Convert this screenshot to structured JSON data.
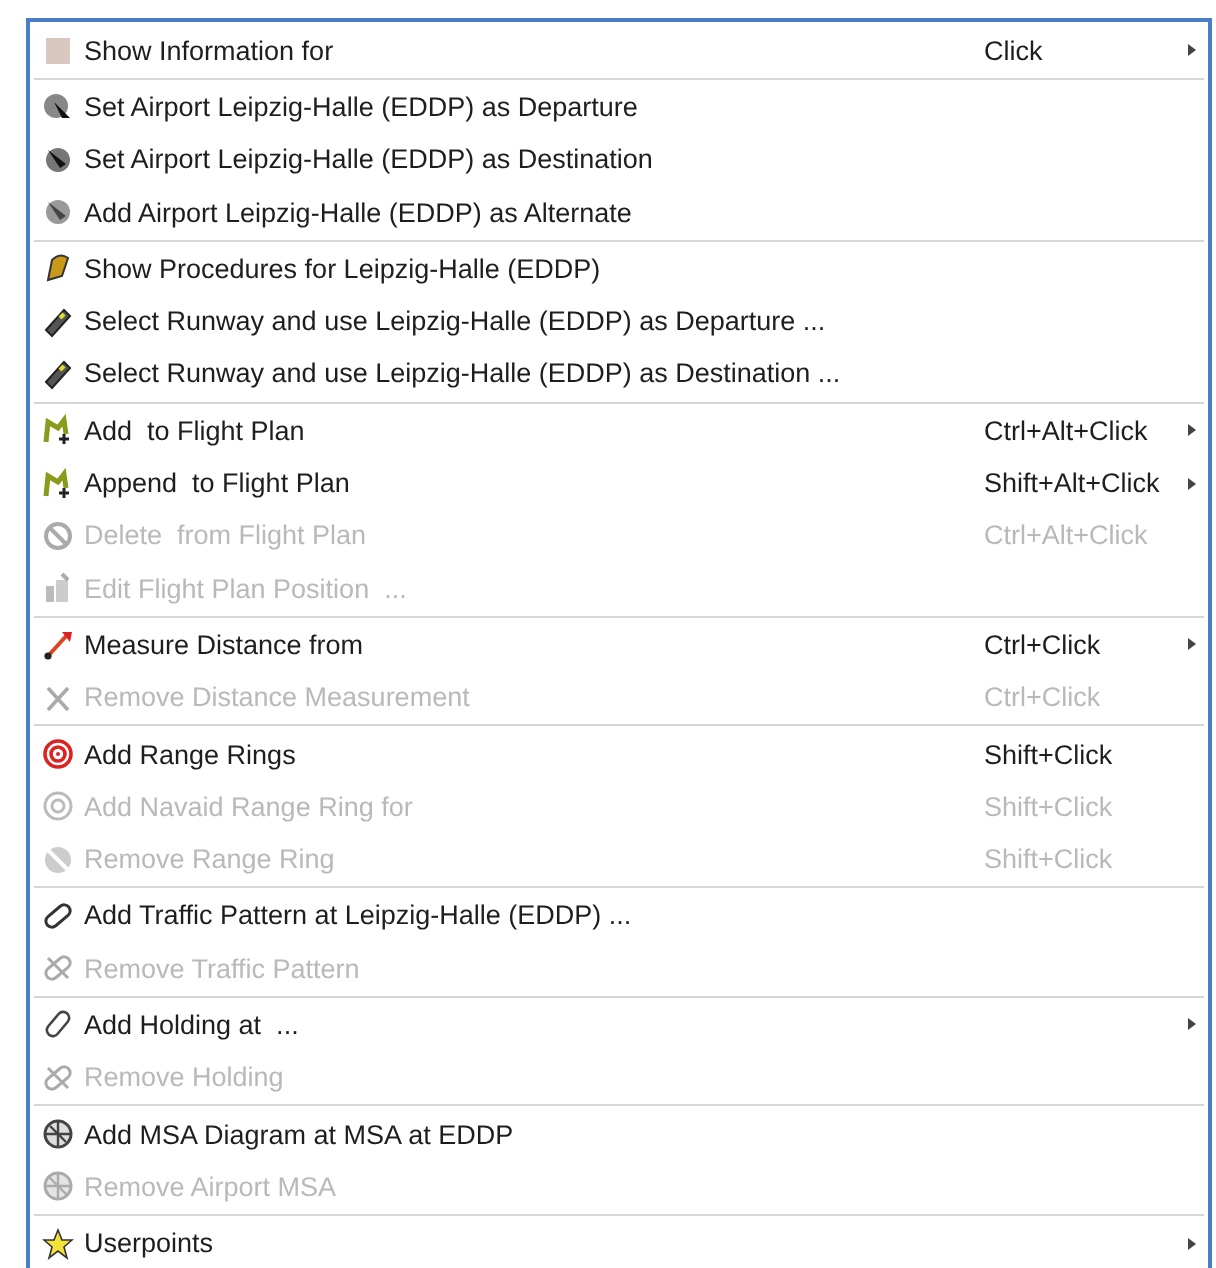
{
  "menu": {
    "groups": [
      {
        "items": [
          {
            "kind": "info",
            "label": "Show Information for",
            "shortcut": "Click",
            "submenu": true,
            "disabled": false
          }
        ]
      },
      {
        "items": [
          {
            "kind": "departure",
            "label": "Set Airport Leipzig-Halle (EDDP) as Departure",
            "submenu": false,
            "disabled": false
          },
          {
            "kind": "destination",
            "label": "Set Airport Leipzig-Halle (EDDP) as Destination",
            "submenu": false,
            "disabled": false
          },
          {
            "kind": "alternate",
            "label": "Add Airport Leipzig-Halle (EDDP) as Alternate",
            "submenu": false,
            "disabled": false
          }
        ]
      },
      {
        "items": [
          {
            "kind": "procedures",
            "label": "Show Procedures for Leipzig-Halle (EDDP)",
            "submenu": false,
            "disabled": false
          },
          {
            "kind": "runway",
            "label": "Select Runway and use Leipzig-Halle (EDDP) as Departure ...",
            "submenu": false,
            "disabled": false
          },
          {
            "kind": "runway",
            "label": "Select Runway and use Leipzig-Halle (EDDP) as Destination ...",
            "submenu": false,
            "disabled": false
          }
        ]
      },
      {
        "items": [
          {
            "kind": "plan",
            "label": "Add  to Flight Plan",
            "shortcut": "Ctrl+Alt+Click",
            "submenu": true,
            "disabled": false
          },
          {
            "kind": "plan",
            "label": "Append  to Flight Plan",
            "shortcut": "Shift+Alt+Click",
            "submenu": true,
            "disabled": false
          },
          {
            "kind": "delete",
            "label": "Delete  from Flight Plan",
            "shortcut": "Ctrl+Alt+Click",
            "submenu": false,
            "disabled": true
          },
          {
            "kind": "edit",
            "label": "Edit Flight Plan Position  ...",
            "submenu": false,
            "disabled": true
          }
        ]
      },
      {
        "items": [
          {
            "kind": "measure",
            "label": "Measure Distance from",
            "shortcut": "Ctrl+Click",
            "submenu": true,
            "disabled": false
          },
          {
            "kind": "unmeasure",
            "label": "Remove Distance Measurement",
            "shortcut": "Ctrl+Click",
            "submenu": false,
            "disabled": true
          }
        ]
      },
      {
        "items": [
          {
            "kind": "rings",
            "label": "Add Range Rings",
            "shortcut": "Shift+Click",
            "submenu": false,
            "disabled": false
          },
          {
            "kind": "ring",
            "label": "Add Navaid Range Ring for",
            "shortcut": "Shift+Click",
            "submenu": false,
            "disabled": true
          },
          {
            "kind": "noring",
            "label": "Remove Range Ring",
            "shortcut": "Shift+Click",
            "submenu": false,
            "disabled": true
          }
        ]
      },
      {
        "items": [
          {
            "kind": "pattern",
            "label": "Add Traffic Pattern at Leipzig-Halle (EDDP) ...",
            "submenu": false,
            "disabled": false
          },
          {
            "kind": "nopattern",
            "label": "Remove Traffic Pattern",
            "submenu": false,
            "disabled": true
          }
        ]
      },
      {
        "items": [
          {
            "kind": "holding",
            "label": "Add Holding at  ...",
            "submenu": true,
            "disabled": false
          },
          {
            "kind": "nopattern",
            "label": "Remove Holding",
            "submenu": false,
            "disabled": true
          }
        ]
      },
      {
        "items": [
          {
            "kind": "msa",
            "label": "Add MSA Diagram at MSA at EDDP",
            "submenu": false,
            "disabled": false
          },
          {
            "kind": "nomsa",
            "label": "Remove Airport MSA",
            "submenu": false,
            "disabled": true
          }
        ]
      },
      {
        "items": [
          {
            "kind": "star",
            "label": "Userpoints",
            "submenu": true,
            "disabled": false
          }
        ]
      }
    ]
  }
}
